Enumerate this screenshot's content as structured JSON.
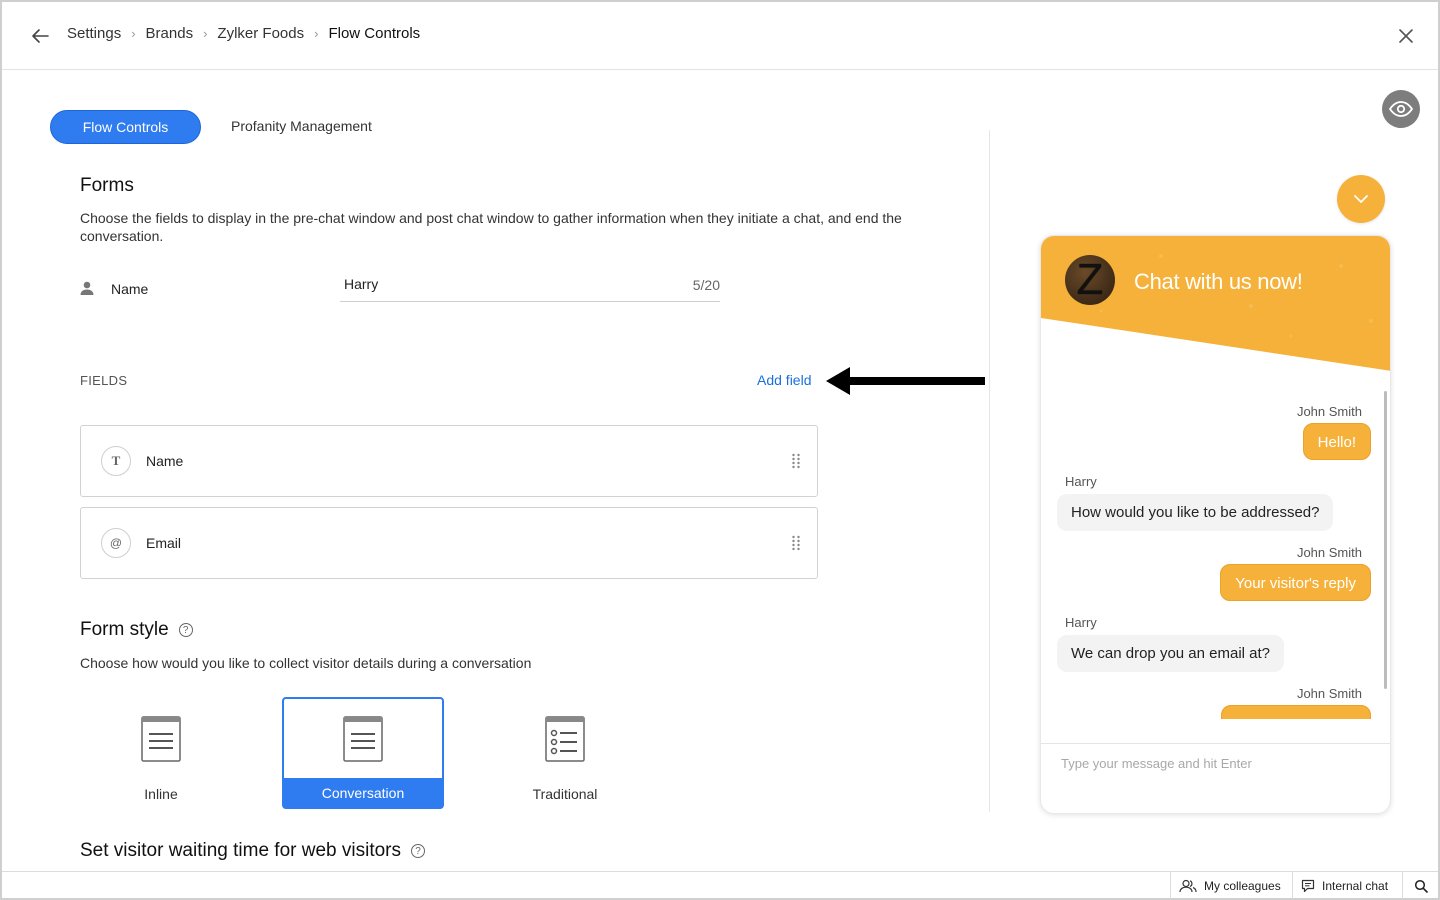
{
  "header": {
    "breadcrumb": [
      "Settings",
      "Brands",
      "Zylker Foods",
      "Flow Controls"
    ]
  },
  "tabs": {
    "active": "Flow Controls",
    "other": "Profanity Management"
  },
  "forms": {
    "title": "Forms",
    "description": "Choose the fields to display in the pre-chat window and post chat window to gather information when they initiate a chat, and end the conversation.",
    "name_label": "Name",
    "name_value": "Harry",
    "char_count": "5/20"
  },
  "fields": {
    "label": "FIELDS",
    "add_label": "Add field",
    "items": [
      {
        "icon": "T",
        "label": "Name"
      },
      {
        "icon": "@",
        "label": "Email"
      }
    ]
  },
  "form_style": {
    "title": "Form style",
    "description": "Choose how would you like to collect visitor details during a conversation",
    "options": [
      "Inline",
      "Conversation",
      "Traditional"
    ],
    "selected": "Conversation"
  },
  "waiting": {
    "title": "Set visitor waiting time for web visitors"
  },
  "widget": {
    "avatar_letter": "Z",
    "title": "Chat with us now!",
    "messages": [
      {
        "sender": "John Smith",
        "text": "Hello!",
        "side": "right"
      },
      {
        "sender": "Harry",
        "text": "How would you like to be addressed?",
        "side": "left"
      },
      {
        "sender": "John Smith",
        "text": "Your visitor's reply",
        "side": "right"
      },
      {
        "sender": "Harry",
        "text": "We can drop you an email at?",
        "side": "left"
      },
      {
        "sender": "John Smith",
        "text": "",
        "side": "right"
      }
    ],
    "input_placeholder": "Type your message and hit Enter"
  },
  "footer": {
    "colleagues": "My colleagues",
    "internal_chat": "Internal chat"
  },
  "colors": {
    "primary": "#2f7bf0",
    "link": "#1a6fe0",
    "widget_accent": "#f5b13a"
  }
}
